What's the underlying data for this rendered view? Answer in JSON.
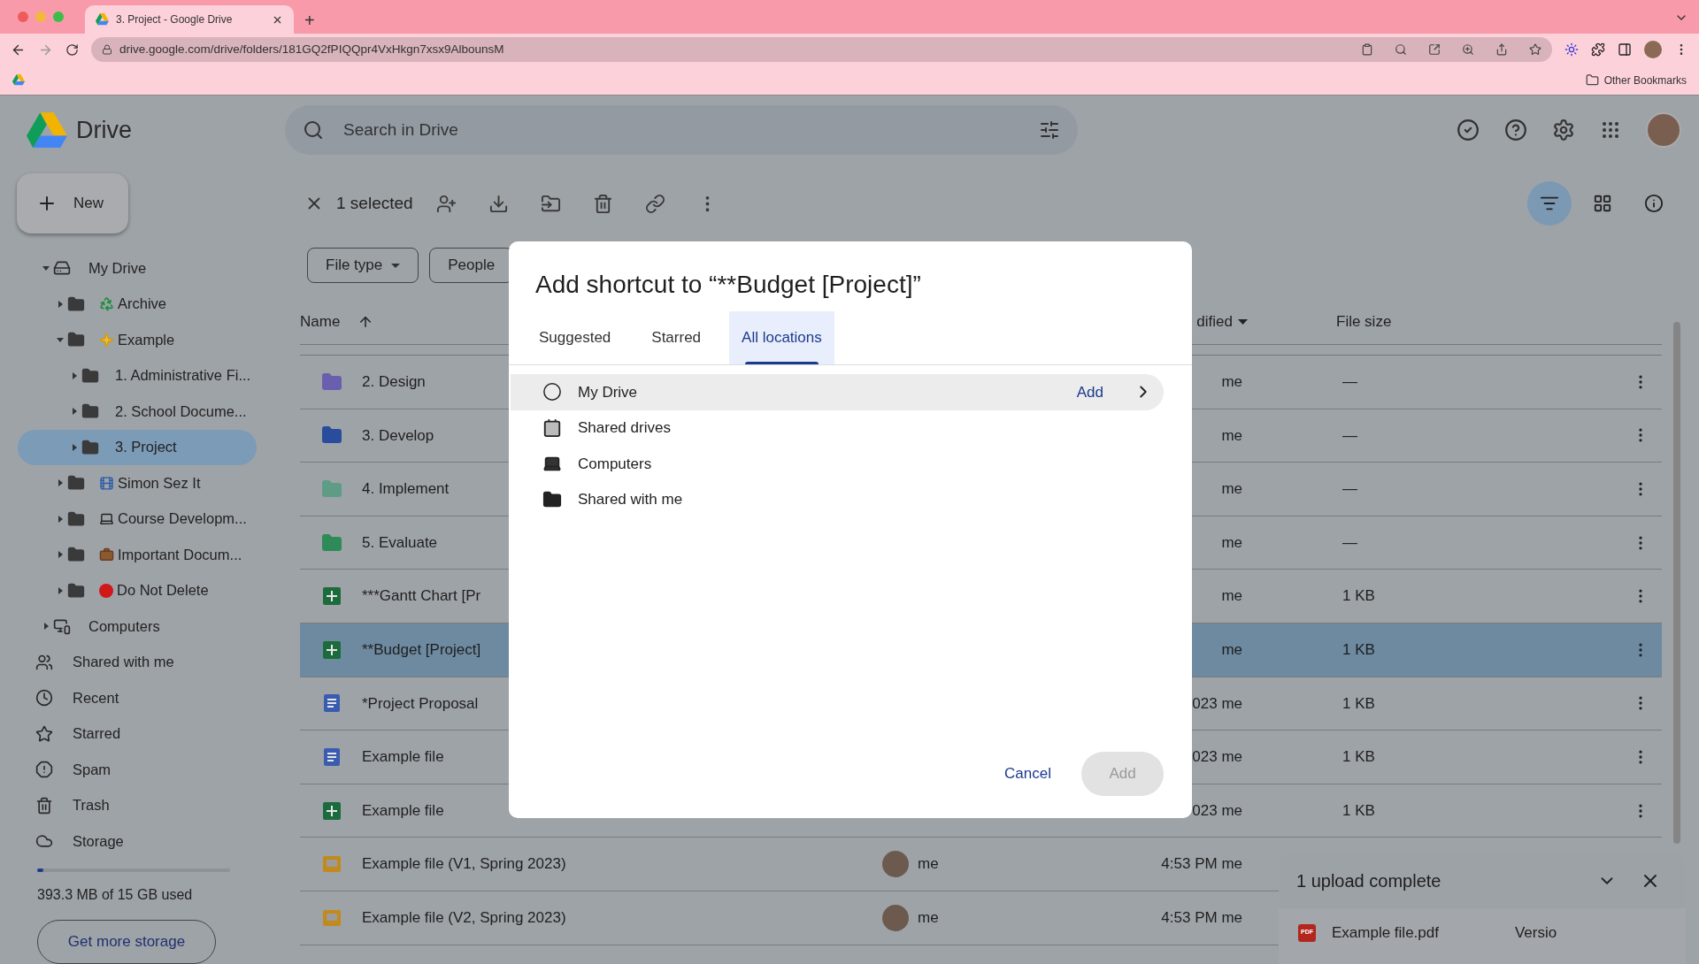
{
  "browser": {
    "tab_title": "3. Project - Google Drive",
    "new_tab": "+",
    "url": "drive.google.com/drive/folders/181GQ2fPIQQpr4VxHkgn7xsx9AlbounsM",
    "bookmark": "Other Bookmarks"
  },
  "header": {
    "app_name": "Drive",
    "search": {
      "placeholder": "Search in Drive"
    }
  },
  "sidebar": {
    "new_button": "New",
    "tree": [
      {
        "label": "My Drive",
        "kind": "drive",
        "expanded": true,
        "selected": false,
        "children": [
          {
            "label": "Archive",
            "kind": "recycle",
            "expanded": false,
            "selected": false
          },
          {
            "label": "Example",
            "kind": "sparkle",
            "expanded": true,
            "selected": false,
            "children": [
              {
                "label": "1. Administrative Fi...",
                "kind": "folder",
                "expanded": false,
                "selected": false
              },
              {
                "label": "2. School Docume...",
                "kind": "folder",
                "expanded": false,
                "selected": false
              },
              {
                "label": "3. Project",
                "kind": "folder",
                "expanded": false,
                "selected": true
              }
            ]
          },
          {
            "label": "Simon Sez It",
            "kind": "film",
            "expanded": false,
            "selected": false
          },
          {
            "label": "Course Developm...",
            "kind": "laptop",
            "expanded": false,
            "selected": false
          },
          {
            "label": "Important Docum...",
            "kind": "briefcase",
            "expanded": false,
            "selected": false
          },
          {
            "label": "Do Not Delete",
            "kind": "dot",
            "expanded": false,
            "selected": false
          }
        ]
      },
      {
        "label": "Computers",
        "kind": "computers",
        "expanded": false,
        "selected": false
      }
    ],
    "nav": [
      {
        "label": "Shared with me",
        "kind": "shared"
      },
      {
        "label": "Recent",
        "kind": "recent"
      },
      {
        "label": "Starred",
        "kind": "starred"
      },
      {
        "label": "Spam",
        "kind": "spam"
      },
      {
        "label": "Trash",
        "kind": "trash"
      },
      {
        "label": "Storage",
        "kind": "storage"
      }
    ],
    "storage": {
      "level": 0.03,
      "text": "393.3 MB of 15 GB used",
      "button": "Get more storage"
    }
  },
  "toolbar": {
    "selection": "1 selected",
    "view": {
      "filter_selected": true
    }
  },
  "filters": [
    "File type",
    "People"
  ],
  "table": {
    "columns": [
      "Name",
      "dified",
      "File size"
    ],
    "rows": [
      {
        "name": "2. Design",
        "kind": "folder",
        "color": "#6a5fae",
        "modified": "me",
        "size": "—",
        "selected": false
      },
      {
        "name": "3. Develop",
        "kind": "folder",
        "color": "#2a4c9c",
        "modified": "me",
        "size": "—",
        "selected": false
      },
      {
        "name": "4. Implement",
        "kind": "folder",
        "color": "#5f9c86",
        "modified": "me",
        "size": "—",
        "selected": false
      },
      {
        "name": "5. Evaluate",
        "kind": "folder",
        "color": "#2e8b57",
        "modified": "me",
        "size": "—",
        "selected": false
      },
      {
        "name": "***Gantt Chart [Pr",
        "kind": "sheet",
        "modified": "me",
        "size": "1 KB",
        "selected": false
      },
      {
        "name": "**Budget [Project]",
        "kind": "sheet",
        "modified": "me",
        "size": "1 KB",
        "selected": true
      },
      {
        "name": "*Project Proposal",
        "kind": "doc",
        "modified": "023 me",
        "size": "1 KB",
        "selected": false
      },
      {
        "name": "Example file",
        "kind": "doc",
        "modified": "023 me",
        "size": "1 KB",
        "selected": false
      },
      {
        "name": "Example file",
        "kind": "sheet",
        "modified": "023 me",
        "size": "1 KB",
        "selected": false
      },
      {
        "name": "Example file (V1, Spring 2023)",
        "kind": "slide",
        "owner": "me",
        "modified": "4:53 PM me",
        "selected": false
      },
      {
        "name": "Example file (V2, Spring 2023)",
        "kind": "slide",
        "owner": "me",
        "modified": "4:53 PM me",
        "selected": false
      }
    ]
  },
  "dialog": {
    "title": "Add shortcut to “**Budget [Project]”",
    "tabs": [
      {
        "label": "Suggested",
        "selected": false
      },
      {
        "label": "Starred",
        "selected": false
      },
      {
        "label": "All locations",
        "selected": true
      }
    ],
    "locations": [
      {
        "label": "My Drive",
        "kind": "drive",
        "hovered": true,
        "action": "Add"
      },
      {
        "label": "Shared drives",
        "kind": "shared-drives",
        "hovered": false
      },
      {
        "label": "Computers",
        "kind": "computers",
        "hovered": false
      },
      {
        "label": "Shared with me",
        "kind": "shared",
        "hovered": false
      }
    ],
    "cancel": "Cancel",
    "confirm": {
      "label": "Add",
      "disabled": true
    }
  },
  "upload": {
    "title": "1 upload complete",
    "file": "Example file.pdf",
    "file_type": "PDF",
    "version": "Versio"
  }
}
